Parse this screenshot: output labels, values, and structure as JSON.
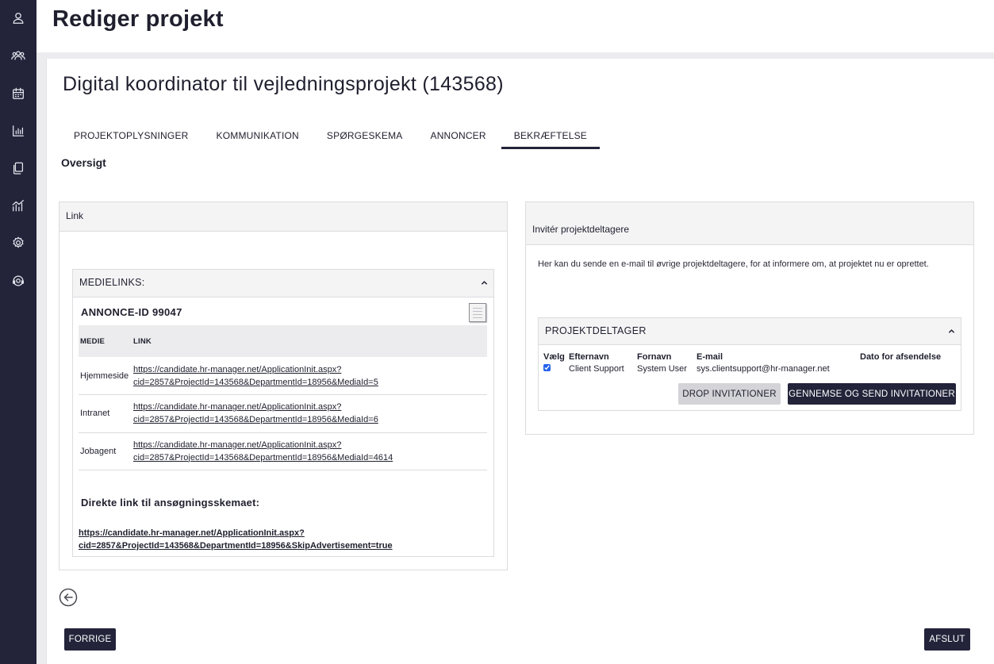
{
  "sidebar": {
    "items": [
      {
        "icon": "user-icon"
      },
      {
        "icon": "users-icon"
      },
      {
        "icon": "calendar-icon"
      },
      {
        "icon": "bar-chart-icon"
      },
      {
        "icon": "documents-icon"
      },
      {
        "icon": "analytics-icon"
      },
      {
        "icon": "gear-icon"
      },
      {
        "icon": "support-icon"
      }
    ]
  },
  "header": {
    "title": "Rediger projekt"
  },
  "project": {
    "title": "Digital koordinator til vejledningsprojekt (143568)"
  },
  "tabs": [
    {
      "label": "PROJEKTOPLYSNINGER"
    },
    {
      "label": "KOMMUNIKATION"
    },
    {
      "label": "SPØRGESKEMA"
    },
    {
      "label": "ANNONCER"
    },
    {
      "label": "BEKRÆFTELSE"
    }
  ],
  "active_tab": "BEKRÆFTELSE",
  "section": {
    "label": "Oversigt"
  },
  "link_panel": {
    "title": "Link",
    "medielinks": {
      "title": "MEDIELINKS:",
      "annonce_id": "ANNONCE-ID 99047",
      "columns": [
        "MEDIE",
        "LINK"
      ],
      "rows": [
        {
          "medie": "Hjemmeside",
          "link_line1": "https://candidate.hr-manager.net/ApplicationInit.aspx?",
          "link_line2": "cid=2857&ProjectId=143568&DepartmentId=18956&MediaId=5"
        },
        {
          "medie": "Intranet",
          "link_line1": "https://candidate.hr-manager.net/ApplicationInit.aspx?",
          "link_line2": "cid=2857&ProjectId=143568&DepartmentId=18956&MediaId=6"
        },
        {
          "medie": "Jobagent",
          "link_line1": "https://candidate.hr-manager.net/ApplicationInit.aspx?",
          "link_line2": "cid=2857&ProjectId=143568&DepartmentId=18956&MediaId=4614"
        }
      ],
      "direct_label": "Direkte link til ansøgningsskemaet:",
      "direct_link_line1": "https://candidate.hr-manager.net/ApplicationInit.aspx?",
      "direct_link_line2": "cid=2857&ProjectId=143568&DepartmentId=18956&SkipAdvertisement=true"
    }
  },
  "invite_panel": {
    "title": "Invitér projektdeltagere",
    "text": "Her kan du sende en e-mail til øvrige projektdeltagere, for at informere om, at projektet nu er oprettet.",
    "deltagere": {
      "title": "PROJEKTDELTAGER",
      "columns": [
        "Vælg",
        "Efternavn",
        "Fornavn",
        "E-mail",
        "Dato for afsendelse"
      ],
      "rows": [
        {
          "checked": true,
          "efternavn": "Client Support",
          "fornavn": "System User",
          "email": "sys.clientsupport@hr-manager.net",
          "dato": ""
        }
      ]
    },
    "drop_button": "DROP INVITATIONER",
    "send_button": "GENNEMSE OG SEND INVITATIONER"
  },
  "footer": {
    "prev_button": "FORRIGE",
    "finish_button": "AFSLUT"
  },
  "colors": {
    "sidebar_bg": "#23243a",
    "primary_button": "#23243a",
    "secondary_button": "#d4d4d8"
  }
}
